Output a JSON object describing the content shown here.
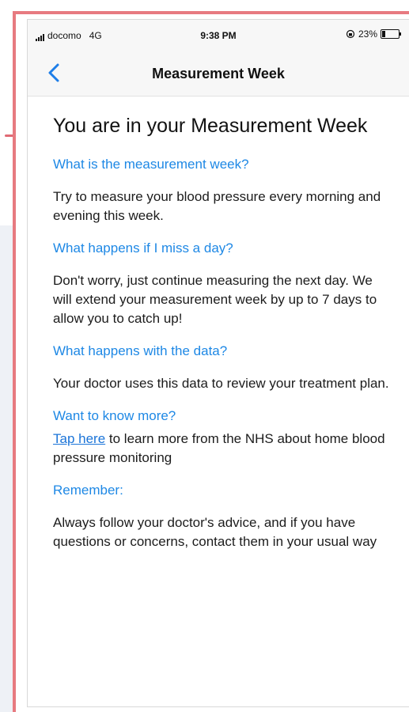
{
  "status_bar": {
    "carrier": "docomo",
    "network": "4G",
    "time": "9:38 PM",
    "battery": "23%"
  },
  "nav": {
    "title": "Measurement Week",
    "back_icon": "chevron-left-icon"
  },
  "content": {
    "title": "You are in your Measurement Week",
    "sections": [
      {
        "question": "What is the measurement week?",
        "answer": "Try to measure your blood pressure every morning and evening this week."
      },
      {
        "question": "What happens if I miss a day?",
        "answer": "Don't worry, just continue measuring the next day. We will extend your measurement week by up to 7 days to allow you to catch up!"
      },
      {
        "question": "What happens with the data?",
        "answer": "Your doctor uses this data to review your treatment plan."
      }
    ],
    "more": {
      "question": "Want to know more?",
      "link_text": "Tap here",
      "after_link": " to learn more from the NHS about home blood pressure monitoring"
    },
    "remember": {
      "question": "Remember:",
      "answer": "Always follow your doctor's advice, and if you have questions or concerns, contact them in your usual way"
    }
  },
  "colors": {
    "accent": "#1e88e5",
    "frame_border": "#e77a80"
  }
}
